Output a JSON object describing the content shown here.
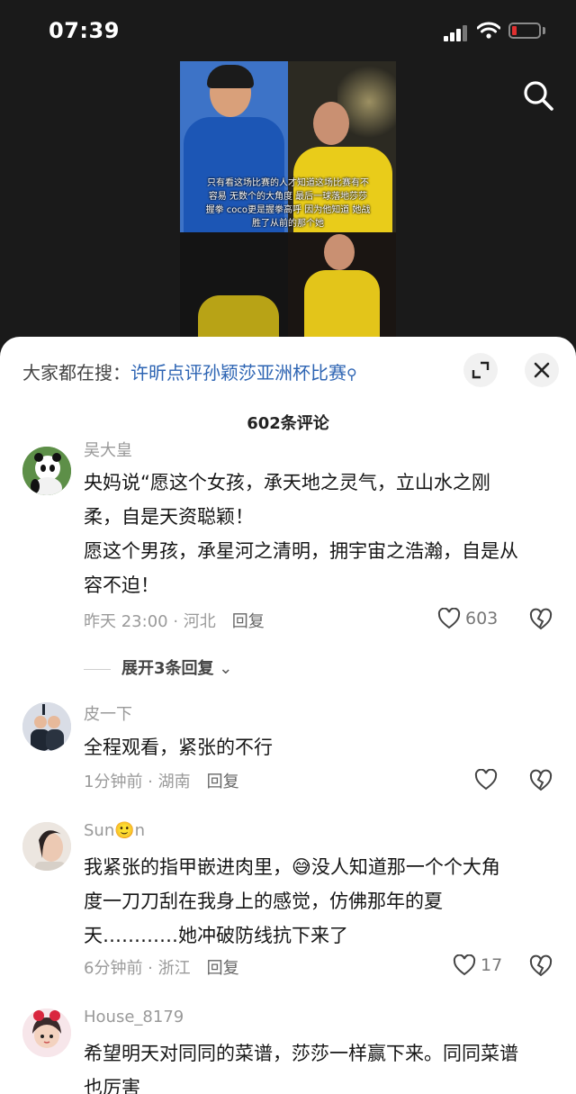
{
  "status_bar": {
    "time": "07:39"
  },
  "video": {
    "caption_lines": [
      "只有看这场比赛的人才知道这场比赛有不",
      "容易 无数个的大角度 最后一球落地莎莎",
      "握拳 coco更是握拳高呼 因为他知道 她战",
      "胜了从前的那个她"
    ]
  },
  "search_suggestion": {
    "prefix": "大家都在搜：",
    "query": "许昕点评孙颖莎亚洲杯比赛"
  },
  "comments_header": {
    "count_text": "602条评论"
  },
  "comments": [
    {
      "username": "吴大皇",
      "lines": [
        "央妈说“愿这个女孩，承天地之灵气，立山水之刚",
        "柔，自是天资聪颖！",
        "愿这个男孩，承星河之清明，拥宇宙之浩瀚，自是从",
        "容不迫！"
      ],
      "time_location": "昨天 23:00 · 河北",
      "reply_label": "回复",
      "likes": "603",
      "expand_text": "展开3条回复"
    },
    {
      "username": "皮一下",
      "lines": [
        "全程观看，紧张的不行"
      ],
      "time_location": "1分钟前 · 湖南",
      "reply_label": "回复",
      "likes": ""
    },
    {
      "username": "Sun🙂n",
      "lines": [
        "我紧张的指甲嵌进肉里，😅没人知道那一个个大角",
        "度一刀刀刮在我身上的感觉，仿佛那年的夏",
        "天…………她冲破防线抗下来了"
      ],
      "time_location": "6分钟前 · 浙江",
      "reply_label": "回复",
      "likes": "17"
    },
    {
      "username": "House_8179",
      "lines": [
        "希望明天对同同的菜谱，莎莎一样赢下来。同同菜谱",
        "也厉害"
      ]
    }
  ],
  "colors": {
    "link": "#2d64b3",
    "battery_low": "#e03030"
  }
}
